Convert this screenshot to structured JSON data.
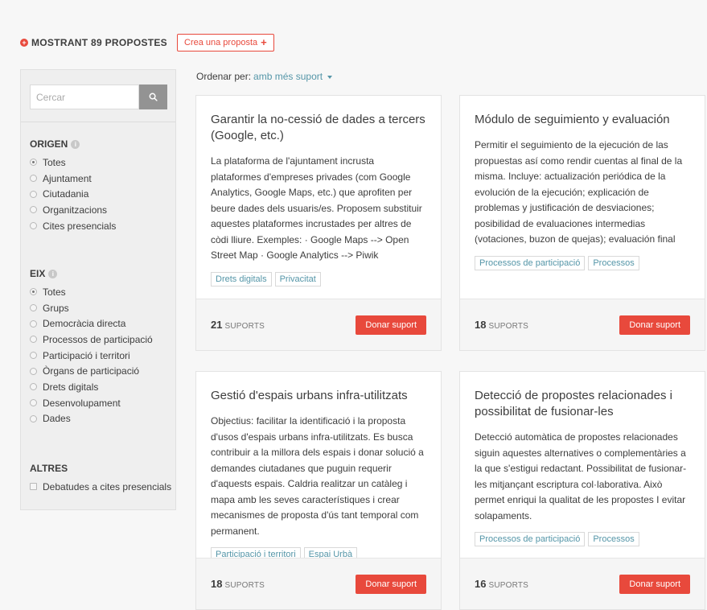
{
  "header": {
    "count_label": "MOSTRANT 89 PROPOSTES",
    "create_label": "Crea una proposta",
    "create_icon": "+"
  },
  "search": {
    "placeholder": "Cercar",
    "icon": "search-icon"
  },
  "filters": {
    "origen": {
      "title": "ORIGEN",
      "selected": "Totes",
      "options": [
        "Totes",
        "Ajuntament",
        "Ciutadania",
        "Organitzacions",
        "Cites presencials"
      ]
    },
    "eix": {
      "title": "EIX",
      "selected": "Totes",
      "options": [
        "Totes",
        "Grups",
        "Democràcia directa",
        "Processos de participació",
        "Participació i territori",
        "Òrgans de participació",
        "Drets digitals",
        "Desenvolupament",
        "Dades"
      ]
    },
    "altres": {
      "title": "ALTRES",
      "options": [
        "Debatudes a cites presencials"
      ]
    }
  },
  "sort": {
    "label": "Ordenar per:",
    "value": "amb més suport"
  },
  "supports_label": "SUPORTS",
  "support_button": "Donar suport",
  "colors": {
    "accent": "#e8493c",
    "link": "#5596a8"
  },
  "cards": [
    {
      "title": "Garantir la no-cessió de dades a tercers (Google, etc.)",
      "description": "La plataforma de l'ajuntament incrusta plataformes d'empreses privades (com Google Analytics, Google Maps, etc.) que aprofiten per beure dades dels usuaris/es. Proposem substituir aquestes plataformes incrustades per altres de còdi lliure. Exemples: · Google Maps --> Open Street Map · Google Analytics --> Piwik",
      "tags": [
        "Drets digitals",
        "Privacitat"
      ],
      "supports": "21"
    },
    {
      "title": "Módulo de seguimiento y evaluación",
      "description": "Permitir el seguimiento de la ejecución de las propuestas así como rendir cuentas al final de la misma. Incluye: actualización periódica de la evolución de la ejecución; explicación de problemas y justificación de desviaciones; posibilidad de evaluaciones intermedias (votaciones, buzon de quejas); evaluación final",
      "tags": [
        "Processos de participació",
        "Processos"
      ],
      "supports": "18"
    },
    {
      "title": "Gestió d'espais urbans infra-utilitzats",
      "description": "Objectius: facilitar la identificació i la proposta d'usos d'espais urbans infra-utilitzats. Es busca contribuir a la millora dels espais i donar solució a demandes ciutadanes que puguin requerir d'aquests espais. Caldria realitzar un catàleg i mapa amb les seves característiques i crear mecanismes de proposta d'ús tant temporal com permanent.",
      "tags": [
        "Participació i territori",
        "Espai Urbà"
      ],
      "supports": "18"
    },
    {
      "title": "Detecció de propostes relacionades i possibilitat de fusionar-les",
      "description": "Detecció automàtica de propostes relacionades siguin aquestes alternatives o complementàries a la que s'estigui redactant. Possibilitat de fusionar-les mitjançant escriptura col·laborativa. Això permet enriqui la qualitat de les propostes I evitar solapaments.",
      "tags": [
        "Processos de participació",
        "Processos"
      ],
      "supports": "16"
    }
  ]
}
